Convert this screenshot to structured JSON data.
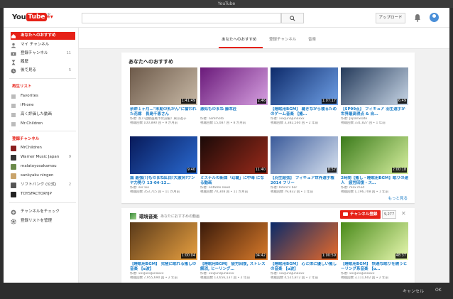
{
  "window": {
    "title": "YouTube"
  },
  "header": {
    "logo_you": "You",
    "logo_tube": "Tube",
    "logo_region": "JP",
    "search_placeholder": "",
    "upload_label": "アップロード"
  },
  "sidebar": {
    "main": [
      {
        "label": "あなたへのおすすめ",
        "icon": "home-icon",
        "active": true
      },
      {
        "label": "マイ チャンネル",
        "icon": "person-icon"
      },
      {
        "label": "登録チャンネル",
        "icon": "subscriptions-icon",
        "count": "11"
      },
      {
        "label": "履歴",
        "icon": "hourglass-icon"
      },
      {
        "label": "後で見る",
        "icon": "clock-icon",
        "count": "5"
      }
    ],
    "playlists_heading": "再生リスト",
    "playlists": [
      {
        "label": "Favorites",
        "icon": "list-icon"
      },
      {
        "label": "iPhone",
        "icon": "list-icon"
      },
      {
        "label": "高く評価した動画",
        "icon": "list-icon"
      },
      {
        "label": "Mr.Children",
        "icon": "list-icon"
      }
    ],
    "subs_heading": "登録チャンネル",
    "subs": [
      {
        "label": "MrChildren",
        "color": "#8a1e1e"
      },
      {
        "label": "Warner Music Japan",
        "count": "9",
        "color": "#333333"
      },
      {
        "label": "malatoyosakamou",
        "color": "#6b8a4a"
      },
      {
        "label": "sankyaku ningen",
        "color": "#c9a46b"
      },
      {
        "label": "ソフトバンク (公式)",
        "count": "2",
        "color": "#555555"
      },
      {
        "label": "TOYSFACTORYJP",
        "color": "#222222"
      }
    ],
    "footer": [
      {
        "label": "チャンネルをチェック",
        "icon": "plus-circle-icon"
      },
      {
        "label": "登録リストを管理",
        "icon": "gear-icon"
      }
    ]
  },
  "tabs": [
    {
      "label": "あなたへのおすすめ",
      "active": true
    },
    {
      "label": "登録チャンネル"
    },
    {
      "label": "音楽"
    }
  ],
  "recommended": {
    "title": "あなたへのおすすめ",
    "more_label": "もっと見る",
    "videos": [
      {
        "title": "余命１ヶ月…\"末期の乳がん\"に誓われた花嫁　長島千恵さん",
        "author": "作者: 煎い話動画蔵市伝説編！東京進子",
        "views": "視聴回数 100,890 回 • 9 か月前",
        "duration": "1:41:49",
        "colors": [
          "#6d5a4a",
          "#c8b9a6"
        ]
      },
      {
        "title": "激似ものまね 藤本匠",
        "author": "作者: asmmoto",
        "views": "視聴回数 15,087 回 • 8 か月前",
        "duration": "2:46",
        "colors": [
          "#6a1a7a",
          "#d6a0e0"
        ]
      },
      {
        "title": "【睡眠用BGM】 聴きながら寝るためのゲーム音楽 【癒…",
        "author": "作者: xxxJunaJunaxxx",
        "views": "視聴回数 3,382,560 回 • 2 年前",
        "duration": "1:07:17",
        "colors": [
          "#0d2a6a",
          "#6fa0e6"
        ]
      },
      {
        "title": "【SP99点】 フィギュア 羽生選手が世界最高得点 & 自…",
        "author": "作者: JapanSkate",
        "views": "視聴回数 331,827 回 • 1 年前",
        "duration": "6:49",
        "colors": [
          "#243a5a",
          "#c8d6e6"
        ]
      },
      {
        "title": "鶉 最強(!)ものまね紅白!大激突!ワンヤ力勢り 13-04-12…",
        "author": "作者: ser kie",
        "views": "視聴回数 353,715 回 • 11 か月前",
        "duration": "9:40",
        "colors": [
          "#081a5a",
          "#2a6ad0"
        ]
      },
      {
        "title": "ミスチルの新曲「幻聴」に中毒 になる動画",
        "author": "作者: entame news",
        "views": "視聴回数 70,308 回 • 11 か月前",
        "duration": "11:40",
        "colors": [
          "#1a0a08",
          "#9a2a1a"
        ]
      },
      {
        "title": "【羽生結弦】 フィギュア世界選手権2014 フリー",
        "author": "作者: Kihiro's bar",
        "views": "視聴回数 79,832 回 • 1 年前",
        "duration": "8:57",
        "colors": [
          "#3a5a9a",
          "#d8e2f0"
        ]
      },
      {
        "title": "2時間【癒し・睡眠用BGM】眠りの達人　疲労回復・ス…",
        "author": "作者: max med",
        "views": "視聴回数 1,196,708 回 • 1 年前",
        "duration": "2:00:18",
        "colors": [
          "#3a7a1a",
          "#d8f0a0"
        ]
      }
    ]
  },
  "channel_shelf": {
    "name": "環境音楽",
    "subtitle": "あなたにおすすめの動画",
    "subscribe_label": "チャンネル登録",
    "subscriber_count": "9,277",
    "videos": [
      {
        "title": "【睡眠用BGM】 究極に眠れる癒しの音楽 【α波】",
        "author": "作者: xxxJunaJunaxxx",
        "views": "視聴回数 7,955,690 回 • 2 年前",
        "duration": "1:00:04",
        "colors": [
          "#5a3a1a",
          "#e8a040"
        ]
      },
      {
        "title": "【睡眠用BGM】 疲労回復, ストレス解消, ヒーリング…",
        "author": "作者: xxxJunaJunaxxx",
        "views": "視聴回数 13,656,137 回 • 2 年前",
        "duration": "04:42",
        "colors": [
          "#3a1a0a",
          "#d87a2a"
        ]
      },
      {
        "title": "【睡眠用BGM】 心と体に優しい癒しの音楽 【α波】",
        "author": "作者: xxxJunaJunaxxx",
        "views": "視聴回数 4,525,872 回 • 2 年前",
        "duration": "1:00:59",
        "colors": [
          "#0a2a6a",
          "#e86a2a"
        ]
      },
      {
        "title": "【睡眠用BGM】 快適な眠りを誘うヒーリング系音楽 【α…",
        "author": "作者: xxxJunaJunaxxx",
        "views": "視聴回数 3,111,602 回 • 2 年前",
        "duration": "48:37",
        "colors": [
          "#4a8a1a",
          "#e8f8b0"
        ]
      }
    ]
  },
  "dialog_buttons": {
    "cancel": "キャンセル",
    "ok": "OK"
  }
}
